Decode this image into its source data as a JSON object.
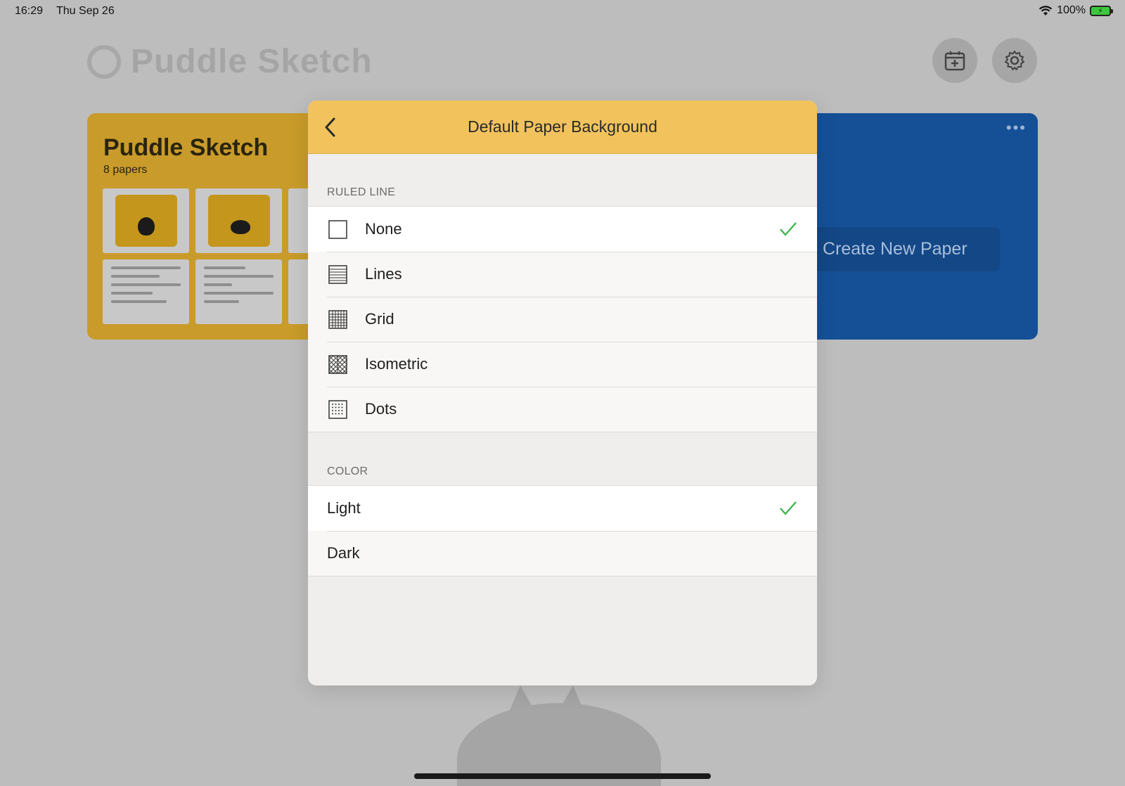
{
  "status_bar": {
    "time": "16:29",
    "date": "Thu Sep 26",
    "battery_percent": "100%"
  },
  "app": {
    "title": "Puddle Sketch"
  },
  "notebook": {
    "title": "Puddle Sketch",
    "count_label": "8 papers"
  },
  "blue_card": {
    "create_label": "Create New Paper"
  },
  "modal": {
    "title": "Default Paper Background",
    "ruled_line_header": "RULED LINE",
    "ruled_options": [
      {
        "label": "None",
        "icon": "blank-square-icon",
        "selected": true
      },
      {
        "label": "Lines",
        "icon": "lines-icon",
        "selected": false
      },
      {
        "label": "Grid",
        "icon": "grid-icon",
        "selected": false
      },
      {
        "label": "Isometric",
        "icon": "isometric-icon",
        "selected": false
      },
      {
        "label": "Dots",
        "icon": "dots-icon",
        "selected": false
      }
    ],
    "color_header": "COLOR",
    "color_options": [
      {
        "label": "Light",
        "selected": true
      },
      {
        "label": "Dark",
        "selected": false
      }
    ]
  },
  "colors": {
    "header_yellow": "#f2c35c",
    "checkmark_green": "#34b545",
    "notebook_yellow": "#c99b2a",
    "notebook_blue": "#155097"
  }
}
